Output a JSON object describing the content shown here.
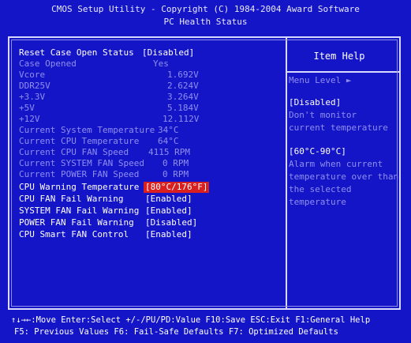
{
  "header": {
    "title_line1": "CMOS Setup Utility - Copyright (C) 1984-2004 Award Software",
    "title_line2": "PC Health Status"
  },
  "main": {
    "rows": [
      {
        "label": "Reset Case Open Status",
        "value": "[Disabled]"
      },
      {
        "label": "Case Opened",
        "value": "Yes"
      },
      {
        "label": "Vcore",
        "value": "1.692V"
      },
      {
        "label": "DDR25V",
        "value": "2.624V"
      },
      {
        "label": "+3.3V",
        "value": "3.264V"
      },
      {
        "label": "+5V",
        "value": "5.184V"
      },
      {
        "label": "+12V",
        "value": "12.112V"
      },
      {
        "label": "Current System Temperature",
        "value": "34°C"
      },
      {
        "label": "Current CPU Temperature",
        "value": "64°C"
      },
      {
        "label": "Current CPU FAN Speed",
        "value": "4115 RPM"
      },
      {
        "label": "Current SYSTEM FAN Speed",
        "value": "0 RPM"
      },
      {
        "label": "Current POWER FAN Speed",
        "value": "0 RPM"
      },
      {
        "label": "CPU Warning Temperature",
        "value": "[80°C/176°F]"
      },
      {
        "label": "CPU FAN Fail Warning",
        "value": "[Enabled]"
      },
      {
        "label": "SYSTEM FAN Fail Warning",
        "value": "[Enabled]"
      },
      {
        "label": "POWER FAN Fail Warning",
        "value": "[Disabled]"
      },
      {
        "label": "CPU Smart FAN Control",
        "value": "[Enabled]"
      }
    ]
  },
  "help": {
    "title": "Item Help",
    "menu_level": "Menu Level  ►",
    "line1": "[Disabled]",
    "line2": "Don't monitor",
    "line3": "current temperature",
    "line4": "[60°C-90°C]",
    "line5": "Alarm when current",
    "line6": "temperature over than",
    "line7": "the selected",
    "line8": "temperature"
  },
  "footer": {
    "line1": "↑↓→←:Move  Enter:Select  +/-/PU/PD:Value  F10:Save  ESC:Exit  F1:General Help",
    "line2": "F5: Previous Values    F6: Fail-Safe Defaults    F7: Optimized Defaults"
  },
  "colors": {
    "background": "#1515c8",
    "selected_highlight": "#d82020",
    "dim_text": "#8f8ff0",
    "readout_text": "#00ffff"
  }
}
